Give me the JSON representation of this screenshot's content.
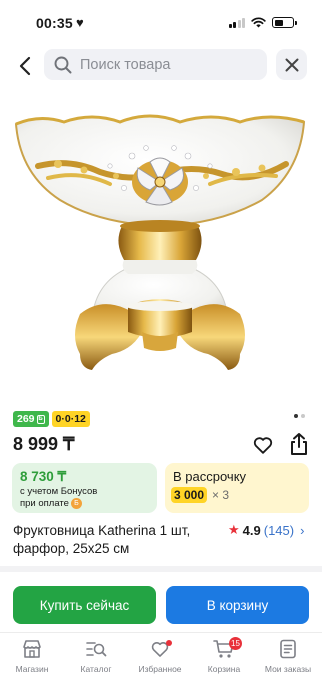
{
  "status_bar": {
    "time": "00:35",
    "heart": "♥"
  },
  "search": {
    "placeholder": "Поиск товара"
  },
  "gallery": {
    "current_image": 1,
    "total_images": 2
  },
  "badges": {
    "bonus": "269",
    "installment": "0·0·12"
  },
  "product": {
    "price": "8 999 ₸",
    "title": "Фруктовница Katherina 1 шт, фарфор, 25x25 см",
    "rating": "4.9",
    "reviews": "(145)"
  },
  "bonus_card": {
    "price": "8 730 ₸",
    "note_line1": "с учетом Бонусов",
    "note_line2": "при оплате"
  },
  "installment_card": {
    "title": "В рассрочку",
    "amount": "3 000",
    "multiplier": "× 3"
  },
  "actions": {
    "buy_now": "Купить сейчас",
    "add_to_cart": "В корзину"
  },
  "tabbar": {
    "items": [
      {
        "label": "Магазин",
        "icon": "store-icon"
      },
      {
        "label": "Каталог",
        "icon": "catalog-search-icon"
      },
      {
        "label": "Избранное",
        "icon": "heart-icon"
      },
      {
        "label": "Корзина",
        "icon": "cart-icon",
        "badge": "15"
      },
      {
        "label": "Мои заказы",
        "icon": "orders-icon"
      }
    ]
  },
  "colors": {
    "green": "#23a444",
    "blue": "#1c7ae2",
    "yellow": "#ffd426",
    "red": "#e8313a",
    "link": "#3a73c9"
  }
}
